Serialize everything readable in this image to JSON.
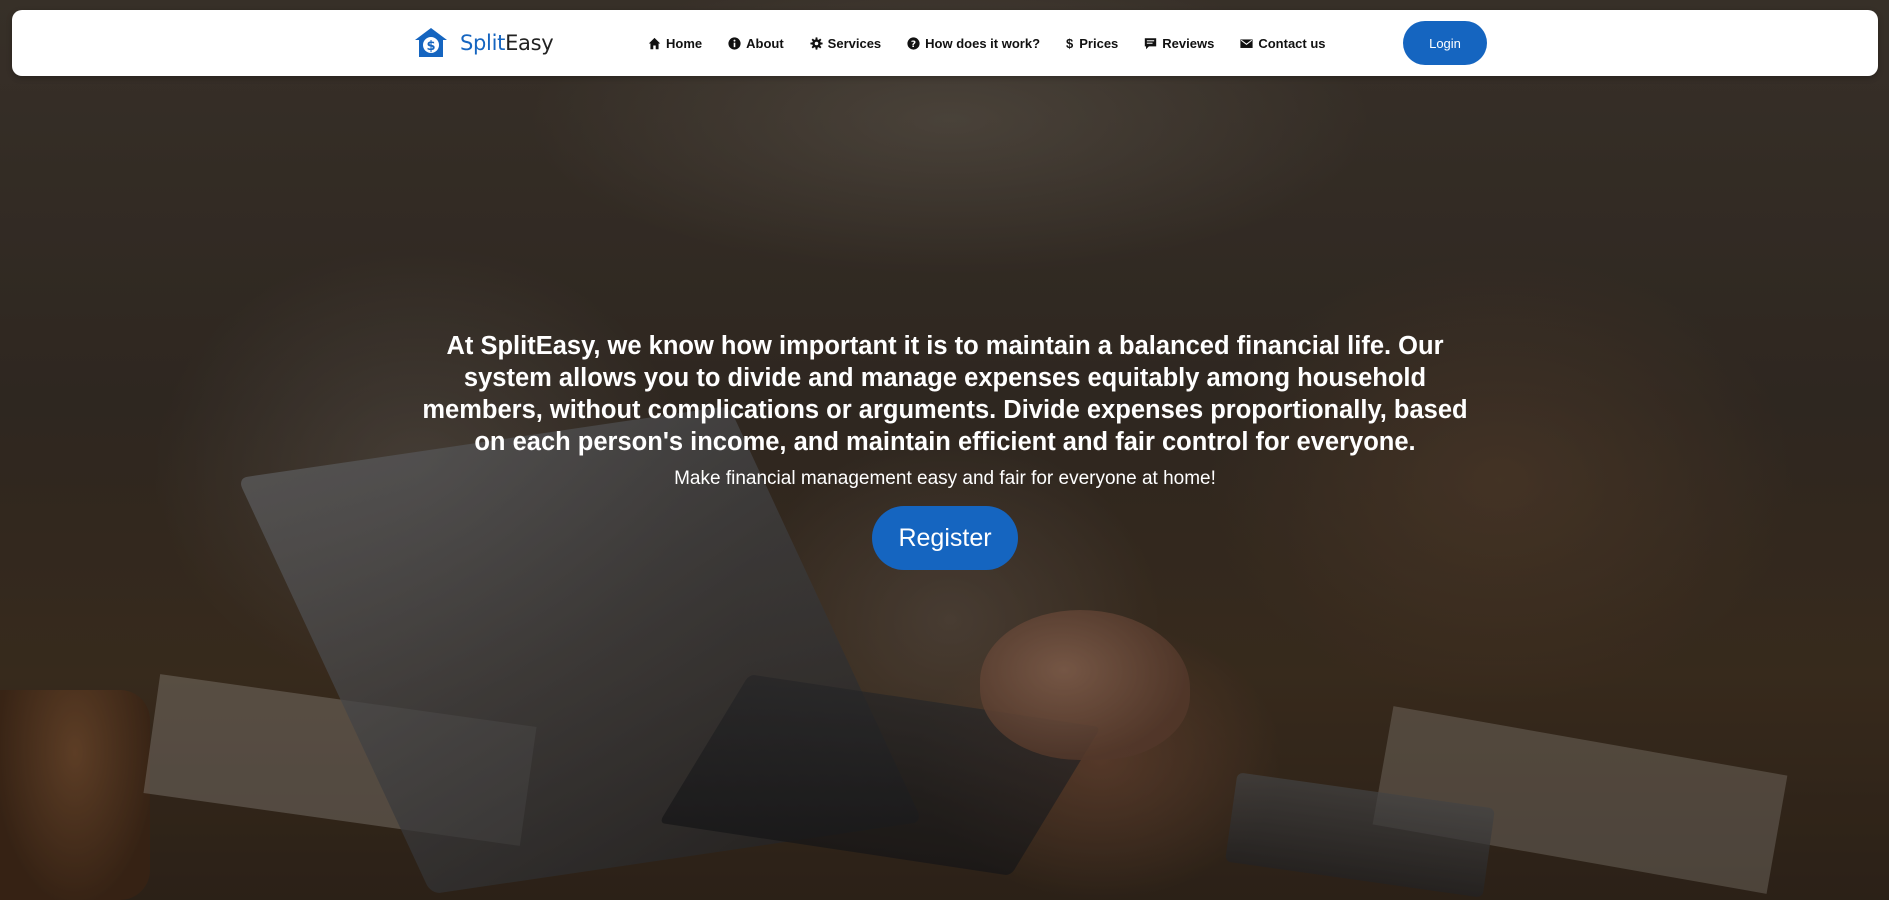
{
  "brand": {
    "name_part1": "Split",
    "name_part2": "Easy",
    "logo_icon": "house-dollar-icon",
    "accent_color": "#1565c0"
  },
  "nav": {
    "items": [
      {
        "label": "Home",
        "icon": "home-icon"
      },
      {
        "label": "About",
        "icon": "info-icon"
      },
      {
        "label": "Services",
        "icon": "gear-icon"
      },
      {
        "label": "How does it work?",
        "icon": "question-icon"
      },
      {
        "label": "Prices",
        "icon": "dollar-icon"
      },
      {
        "label": "Reviews",
        "icon": "comment-icon"
      },
      {
        "label": "Contact us",
        "icon": "envelope-icon"
      }
    ],
    "login_label": "Login"
  },
  "hero": {
    "headline": "At SplitEasy, we know how important it is to maintain a balanced financial life. Our system allows you to divide and manage expenses equitably among household members, without complications or arguments. Divide expenses proportionally, based on each person's income, and maintain efficient and fair control for everyone.",
    "subheadline": "Make financial management easy and fair for everyone at home!",
    "register_label": "Register"
  }
}
